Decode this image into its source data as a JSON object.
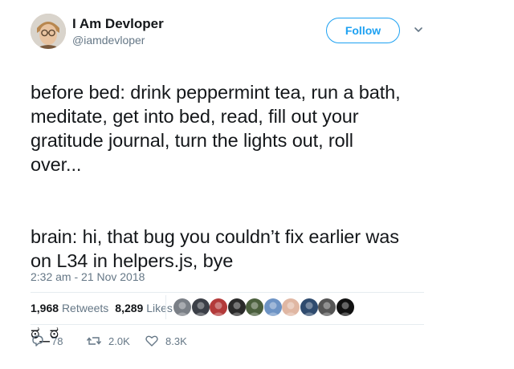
{
  "user": {
    "name": "I Am Devloper",
    "handle": "@iamdevloper",
    "follow_label": "Follow"
  },
  "tweet": {
    "paragraph1": "before bed: drink peppermint tea, run a bath,\nmeditate, get into bed, read, fill out your\ngratitude journal, turn the lights out, roll\nover...",
    "paragraph2": "brain: hi, that bug you couldn’t fix earlier was\non L34 in helpers.js, bye",
    "face": "ಠ_ಠ",
    "timestamp": "2:32 am - 21 Nov 2018"
  },
  "stats": {
    "retweets_count": "1,968",
    "retweets_label": "Retweets",
    "likes_count": "8,289",
    "likes_label": "Likes"
  },
  "likers": [
    {
      "color": "#7a7f86"
    },
    {
      "color": "#3b3f47"
    },
    {
      "color": "#b33a3a"
    },
    {
      "color": "#2a2a2a"
    },
    {
      "color": "#4b5f3d"
    },
    {
      "color": "#6d93c4"
    },
    {
      "color": "#e0b7a3"
    },
    {
      "color": "#2f4b6e"
    },
    {
      "color": "#555555"
    },
    {
      "color": "#111111"
    }
  ],
  "actions": {
    "replies": "78",
    "retweets": "2.0K",
    "likes": "8.3K"
  },
  "colors": {
    "accent": "#1da1f2",
    "secondary_text": "#657786",
    "divider": "#e6ecf0"
  }
}
